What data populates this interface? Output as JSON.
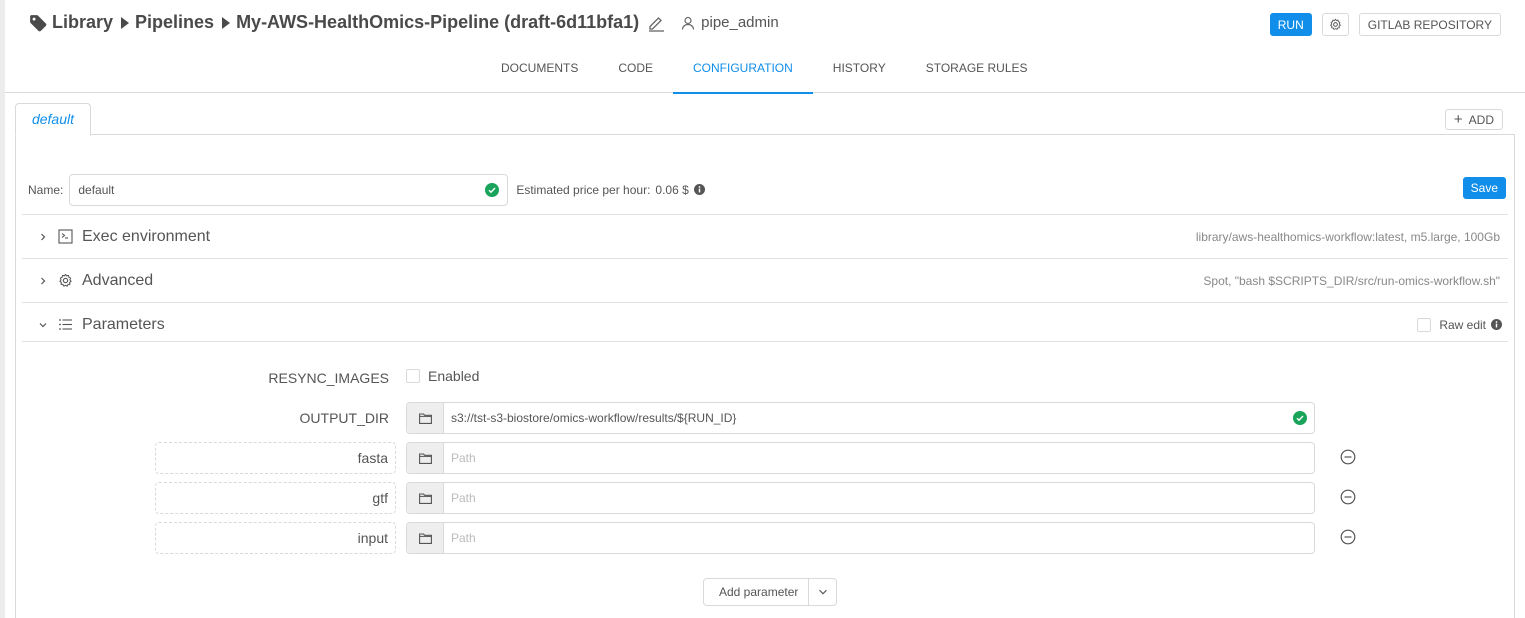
{
  "header": {
    "breadcrumb": [
      "Library",
      "Pipelines",
      "My-AWS-HealthOmics-Pipeline (draft-6d11bfa1)"
    ],
    "owner": "pipe_admin",
    "run_label": "RUN",
    "repo_label": "GITLAB REPOSITORY"
  },
  "tabs": [
    {
      "label": "DOCUMENTS",
      "active": false
    },
    {
      "label": "CODE",
      "active": false
    },
    {
      "label": "CONFIGURATION",
      "active": true
    },
    {
      "label": "HISTORY",
      "active": false
    },
    {
      "label": "STORAGE RULES",
      "active": false
    }
  ],
  "config": {
    "tab_label": "default",
    "add_label": "ADD",
    "name_label": "Name:",
    "name_value": "default",
    "price_label": "Estimated price per hour:",
    "price_value": "0.06 $",
    "save_label": "Save",
    "sections": {
      "exec": {
        "title": "Exec environment",
        "summary": "library/aws-healthomics-workflow:latest,  m5.large,  100Gb",
        "expanded": false
      },
      "advanced": {
        "title": "Advanced",
        "summary": "Spot,  \"bash $SCRIPTS_DIR/src/run-omics-workflow.sh\"",
        "expanded": false
      },
      "parameters": {
        "title": "Parameters",
        "expanded": true,
        "raw_edit_label": "Raw edit",
        "raw_edit_checked": false
      }
    },
    "parameters": {
      "resync": {
        "name": "RESYNC_IMAGES",
        "checkbox_label": "Enabled",
        "checked": false
      },
      "output_dir": {
        "name": "OUTPUT_DIR",
        "value": "s3://tst-s3-biostore/omics-workflow/results/${RUN_ID}"
      },
      "custom": [
        {
          "name": "fasta",
          "value": "",
          "placeholder": "Path"
        },
        {
          "name": "gtf",
          "value": "",
          "placeholder": "Path"
        },
        {
          "name": "input",
          "value": "",
          "placeholder": "Path"
        }
      ],
      "add_label": "Add parameter"
    }
  },
  "colors": {
    "accent": "#108ee9",
    "success": "#1aa35a"
  }
}
